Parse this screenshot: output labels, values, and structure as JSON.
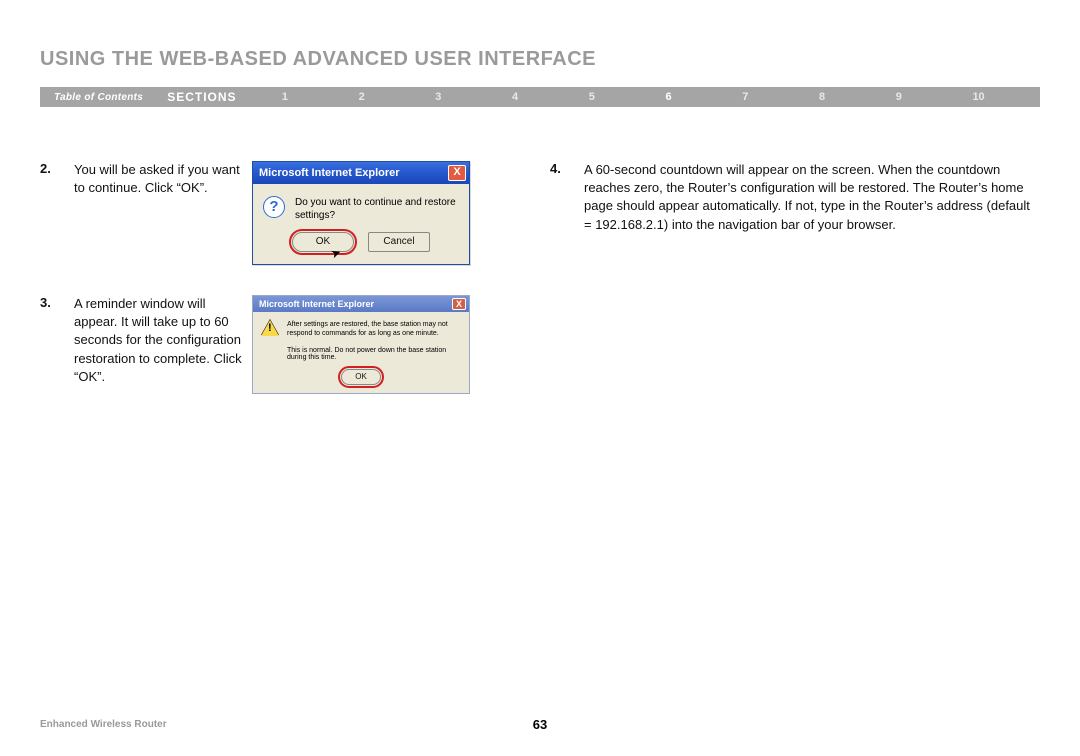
{
  "header": {
    "title": "USING THE WEB-BASED ADVANCED USER INTERFACE"
  },
  "nav": {
    "toc": "Table of Contents",
    "sections_label": "SECTIONS",
    "items": [
      "1",
      "2",
      "3",
      "4",
      "5",
      "6",
      "7",
      "8",
      "9",
      "10"
    ],
    "active_index": 5
  },
  "steps": {
    "s2": {
      "num": "2.",
      "text": "You will be asked if you want to continue. Click “OK”."
    },
    "s3": {
      "num": "3.",
      "text": "A reminder window will appear. It will take up to 60 seconds for the configuration restoration to complete. Click “OK”."
    },
    "s4": {
      "num": "4.",
      "text": "A 60-second countdown will appear on the screen. When the countdown reaches zero, the Router’s configuration will be restored. The Router’s home page should appear automatically. If not, type in the Router’s address (default = 192.168.2.1) into the navigation bar of your browser."
    }
  },
  "dialog1": {
    "title": "Microsoft Internet Explorer",
    "close": "X",
    "q_icon": "?",
    "message": "Do you want to continue and restore settings?",
    "ok": "OK",
    "cancel": "Cancel"
  },
  "dialog2": {
    "title": "Microsoft Internet Explorer",
    "close": "X",
    "warn_excl": "!",
    "message1": "After settings are restored, the base station may not respond to commands for as long as one minute.",
    "message2": "This is normal. Do not power down the base station during this time.",
    "ok": "OK"
  },
  "footer": {
    "left": "Enhanced Wireless Router",
    "page": "63"
  }
}
